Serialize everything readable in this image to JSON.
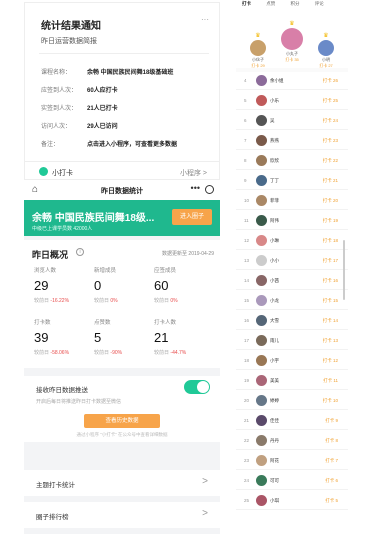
{
  "notice": {
    "title": "统计结果通知",
    "subtitle": "昨日运营数据简报",
    "more": "···",
    "rows": [
      {
        "key": "课程名称：",
        "value": "余畅 中国民族民间舞18级基础班"
      },
      {
        "key": "应签到人次：",
        "value": "60人应打卡"
      },
      {
        "key": "实签到人次：",
        "value": "21人已打卡"
      },
      {
        "key": "访问人次：",
        "value": "29人已访问"
      },
      {
        "key": "备注：",
        "value": "点击进入小程序，可查看更多数据"
      }
    ],
    "footer_app": "小打卡",
    "footer_mp": "小程序 >"
  },
  "stats_page": {
    "nav_title": "昨日数据统计",
    "nav_dots": "•••",
    "banner_name": "余畅 中国民族民间舞18级...",
    "banner_sub": "中级已上课学员数 42000人",
    "banner_button": "进入圈子",
    "overview_title": "昨日概况",
    "overview_info": "i",
    "overview_date": "数据更新至 2019-04-29",
    "metrics": [
      {
        "label": "浏览人数",
        "value": "29",
        "change": "较前日",
        "delta": "-16.22%"
      },
      {
        "label": "新增成员",
        "value": "0",
        "change": "较前日",
        "delta": "0%"
      },
      {
        "label": "应签成员",
        "value": "60",
        "change": "较前日",
        "delta": "0%"
      },
      {
        "label": "打卡数",
        "value": "39",
        "change": "较前日",
        "delta": "-58.06%"
      },
      {
        "label": "点赞数",
        "value": "5",
        "change": "较前日",
        "delta": "-90%"
      },
      {
        "label": "打卡人数",
        "value": "21",
        "change": "较前日",
        "delta": "-44.7%"
      }
    ],
    "toggle_label": "接收昨日数据推送",
    "toggle_desc": "开启后每日将推送昨日打卡数据至微信",
    "toggle_button": "查看历史数据",
    "toggle_hint": "通过小程序 “小打卡” 在公众号中查看详细数据",
    "nav_rows": [
      {
        "label": "主题打卡统计",
        "arrow": ">"
      },
      {
        "label": "圈子排行榜",
        "arrow": ">"
      }
    ]
  },
  "ranking": {
    "tabs": [
      "打卡",
      "点赞",
      "积分",
      "评论"
    ],
    "podium": [
      {
        "rank": "2",
        "name": "小伙子",
        "score": "打卡 29",
        "color": "#c8a06a"
      },
      {
        "rank": "1",
        "name": "小丸子",
        "score": "打卡 35",
        "color": "#d87fa8"
      },
      {
        "rank": "3",
        "name": "小明",
        "score": "打卡 27",
        "color": "#6a8ac8"
      }
    ],
    "rows": [
      {
        "n": "4",
        "name": "余小姐",
        "score": "打卡 26",
        "color": "#8c6b9a"
      },
      {
        "n": "5",
        "name": "小乐",
        "score": "打卡 25",
        "color": "#c05a5a"
      },
      {
        "n": "6",
        "name": "吴",
        "score": "打卡 24",
        "color": "#555555"
      },
      {
        "n": "7",
        "name": "燕燕",
        "score": "打卡 23",
        "color": "#7a5a4a"
      },
      {
        "n": "8",
        "name": "欣欣",
        "score": "打卡 22",
        "color": "#9a7a5a"
      },
      {
        "n": "9",
        "name": "丁丁",
        "score": "打卡 21",
        "color": "#4a6a8a"
      },
      {
        "n": "10",
        "name": "菲菲",
        "score": "打卡 20",
        "color": "#aa8866"
      },
      {
        "n": "11",
        "name": "阿伟",
        "score": "打卡 19",
        "color": "#3a5a4a"
      },
      {
        "n": "12",
        "name": "小琳",
        "score": "打卡 18",
        "color": "#d88888"
      },
      {
        "n": "13",
        "name": "小小",
        "score": "打卡 17",
        "color": "#cccccc"
      },
      {
        "n": "14",
        "name": "小茜",
        "score": "打卡 16",
        "color": "#886666"
      },
      {
        "n": "15",
        "name": "小龙",
        "score": "打卡 15",
        "color": "#aa99bb"
      },
      {
        "n": "16",
        "name": "大雪",
        "score": "打卡 14",
        "color": "#556677"
      },
      {
        "n": "17",
        "name": "雨儿",
        "score": "打卡 13",
        "color": "#7a6a5a"
      },
      {
        "n": "18",
        "name": "小宇",
        "score": "打卡 12",
        "color": "#997755"
      },
      {
        "n": "19",
        "name": "美美",
        "score": "打卡 11",
        "color": "#aa6677"
      },
      {
        "n": "20",
        "name": "婷婷",
        "score": "打卡 10",
        "color": "#667788"
      },
      {
        "n": "21",
        "name": "佳佳",
        "score": "打卡 9",
        "color": "#5a4a6a"
      },
      {
        "n": "22",
        "name": "丹丹",
        "score": "打卡 8",
        "color": "#8a7a6a"
      },
      {
        "n": "23",
        "name": "阿花",
        "score": "打卡 7",
        "color": "#c0a080"
      },
      {
        "n": "24",
        "name": "可可",
        "score": "打卡 6",
        "color": "#3a7a5a"
      },
      {
        "n": "25",
        "name": "小琪",
        "score": "打卡 5",
        "color": "#aa5566"
      }
    ]
  }
}
